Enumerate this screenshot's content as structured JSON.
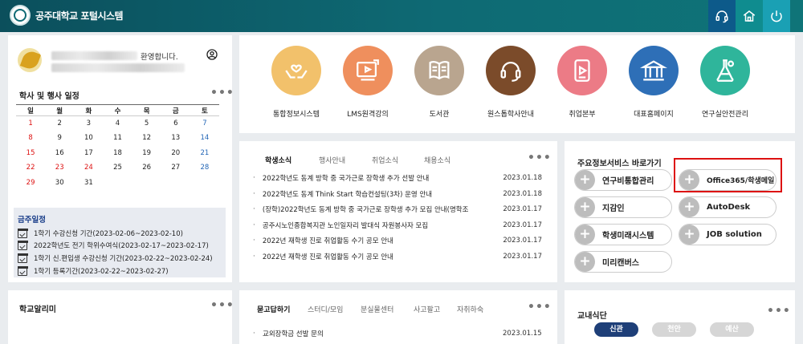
{
  "header": {
    "title": "공주대학교 포털시스템",
    "buttons": [
      {
        "icon": "headset-icon",
        "color": "#0d5a8a"
      },
      {
        "icon": "home-icon",
        "color": "#0f8c8f"
      },
      {
        "icon": "power-icon",
        "color": "#1aa0b4"
      }
    ]
  },
  "user": {
    "welcome": "환영합니다."
  },
  "schedule": {
    "title": "학사 및 행사 일정",
    "more": "•••",
    "weekdays": [
      "일",
      "월",
      "화",
      "수",
      "목",
      "금",
      "토"
    ],
    "weeks": [
      [
        "1",
        "2",
        "3",
        "4",
        "5",
        "6",
        "7"
      ],
      [
        "8",
        "9",
        "10",
        "11",
        "12",
        "13",
        "14"
      ],
      [
        "15",
        "16",
        "17",
        "18",
        "19",
        "20",
        "21"
      ],
      [
        "22",
        "23",
        "24",
        "25",
        "26",
        "27",
        "28"
      ],
      [
        "29",
        "30",
        "31",
        "",
        "",
        "",
        ""
      ]
    ],
    "red_days": [
      "22",
      "23",
      "24"
    ],
    "week_title": "금주일정",
    "week_items": [
      "1학기 수강신청 기간(2023-02-06~2023-02-10)",
      "2022학년도 전기 학위수여식(2023-02-17~2023-02-17)",
      "1학기 신.편입생 수강신청 기간(2023-02-22~2023-02-24)",
      "1학기 등록기간(2023-02-22~2023-02-27)"
    ]
  },
  "services": [
    {
      "label": "통합정보시스템",
      "color": "#f2c16b",
      "icon": "hands-heart-icon"
    },
    {
      "label": "LMS원격강의",
      "color": "#ef8f5d",
      "icon": "video-lecture-icon"
    },
    {
      "label": "도서관",
      "color": "#b9a58f",
      "icon": "book-icon"
    },
    {
      "label": "원스톱학사안내",
      "color": "#7b4b2a",
      "icon": "headset-icon"
    },
    {
      "label": "취업본부",
      "color": "#ec7b86",
      "icon": "tablet-play-icon"
    },
    {
      "label": "대표홈페이지",
      "color": "#2e6fb7",
      "icon": "building-icon"
    },
    {
      "label": "연구실안전관리",
      "color": "#2fb59b",
      "icon": "flask-icon"
    }
  ],
  "news": {
    "tabs": [
      "학생소식",
      "행사안내",
      "취업소식",
      "채용소식"
    ],
    "more": "•••",
    "items": [
      {
        "text": "2022학년도 동계 방학 중 국가근로 장학생 추가 선발 안내",
        "date": "2023.01.18"
      },
      {
        "text": "2022학년도 동계 Think Start 학습컨설팅(3차) 운영 안내",
        "date": "2023.01.18"
      },
      {
        "text": "(장학)2022학년도 동계 방학 중 국가근로 장학생 추가 모집 안내(명학조",
        "date": "2023.01.17"
      },
      {
        "text": "공주시노인종합복지관 노인일자리 발대식 자원봉사자 모집",
        "date": "2023.01.17"
      },
      {
        "text": "2022년 재학생 진로 취업활동 수기 공모 안내",
        "date": "2023.01.17"
      },
      {
        "text": "2022년 재학생 진로 취업활동 수기 공모 안내",
        "date": "2023.01.17"
      }
    ]
  },
  "quicklinks": {
    "title": "주요정보서비스 바로가기",
    "items": [
      "연구비통합관리",
      "Office365/학생메일",
      "지감인",
      "AutoDesk",
      "학생미래시스템",
      "JOB solution",
      "미리캔버스"
    ]
  },
  "school_notice": {
    "title": "학교알리미",
    "more": "•••"
  },
  "qa": {
    "tabs": [
      "묻고답하기",
      "스터디/모임",
      "분실물센터",
      "사고팔고",
      "자취하숙"
    ],
    "more": "•••",
    "items": [
      {
        "text": "교외장학금 선발 문의",
        "date": "2023.01.15"
      }
    ]
  },
  "cafeteria": {
    "title": "교내식단",
    "more": "•••",
    "campuses": [
      {
        "label": "신관",
        "color": "#1e3f78"
      },
      {
        "label": "천안",
        "color": "#d6d6d6"
      },
      {
        "label": "예산",
        "color": "#d6d6d6"
      }
    ]
  }
}
